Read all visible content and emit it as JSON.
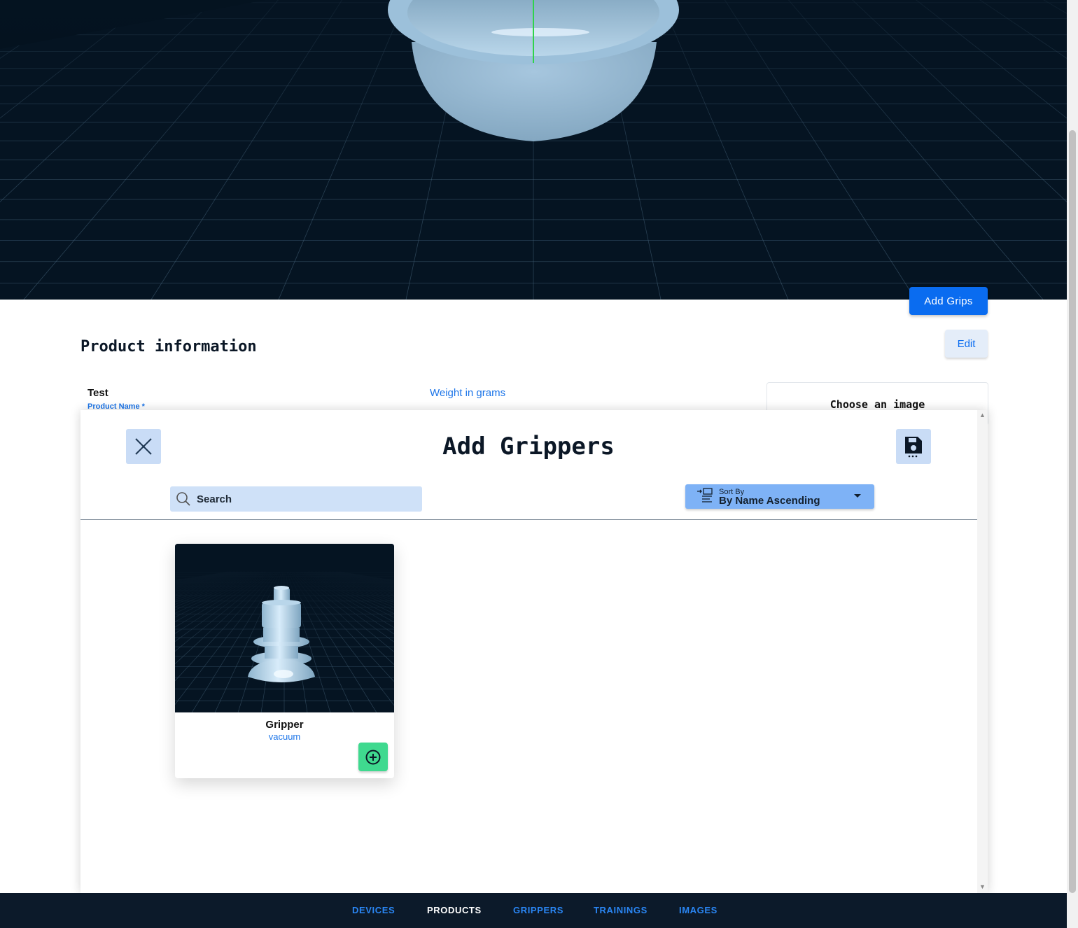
{
  "viewport": {
    "add_grips_label": "Add Grips"
  },
  "product_info": {
    "title": "Product information",
    "edit_label": "Edit",
    "product_name_value": "Test",
    "product_name_label": "Product Name *",
    "weight_label": "Weight in grams",
    "image_chooser_label": "Choose an image"
  },
  "modal": {
    "title": "Add Grippers",
    "close_icon": "close-icon",
    "save_icon": "save-icon",
    "search": {
      "placeholder": "Search",
      "value": ""
    },
    "sort": {
      "label": "Sort By",
      "value": "By Name Ascending"
    },
    "grippers": [
      {
        "name": "Gripper",
        "type": "vacuum",
        "add_icon": "plus-circle-icon"
      }
    ]
  },
  "nav": {
    "items": [
      {
        "label": "DEVICES",
        "active": false
      },
      {
        "label": "PRODUCTS",
        "active": true
      },
      {
        "label": "GRIPPERS",
        "active": false
      },
      {
        "label": "TRAININGS",
        "active": false
      },
      {
        "label": "IMAGES",
        "active": false
      }
    ]
  },
  "colors": {
    "accent": "#0a6cf0",
    "nav_background": "#0c1a2a",
    "add_button": "#3fd98f",
    "viewport_background": "#051422"
  }
}
